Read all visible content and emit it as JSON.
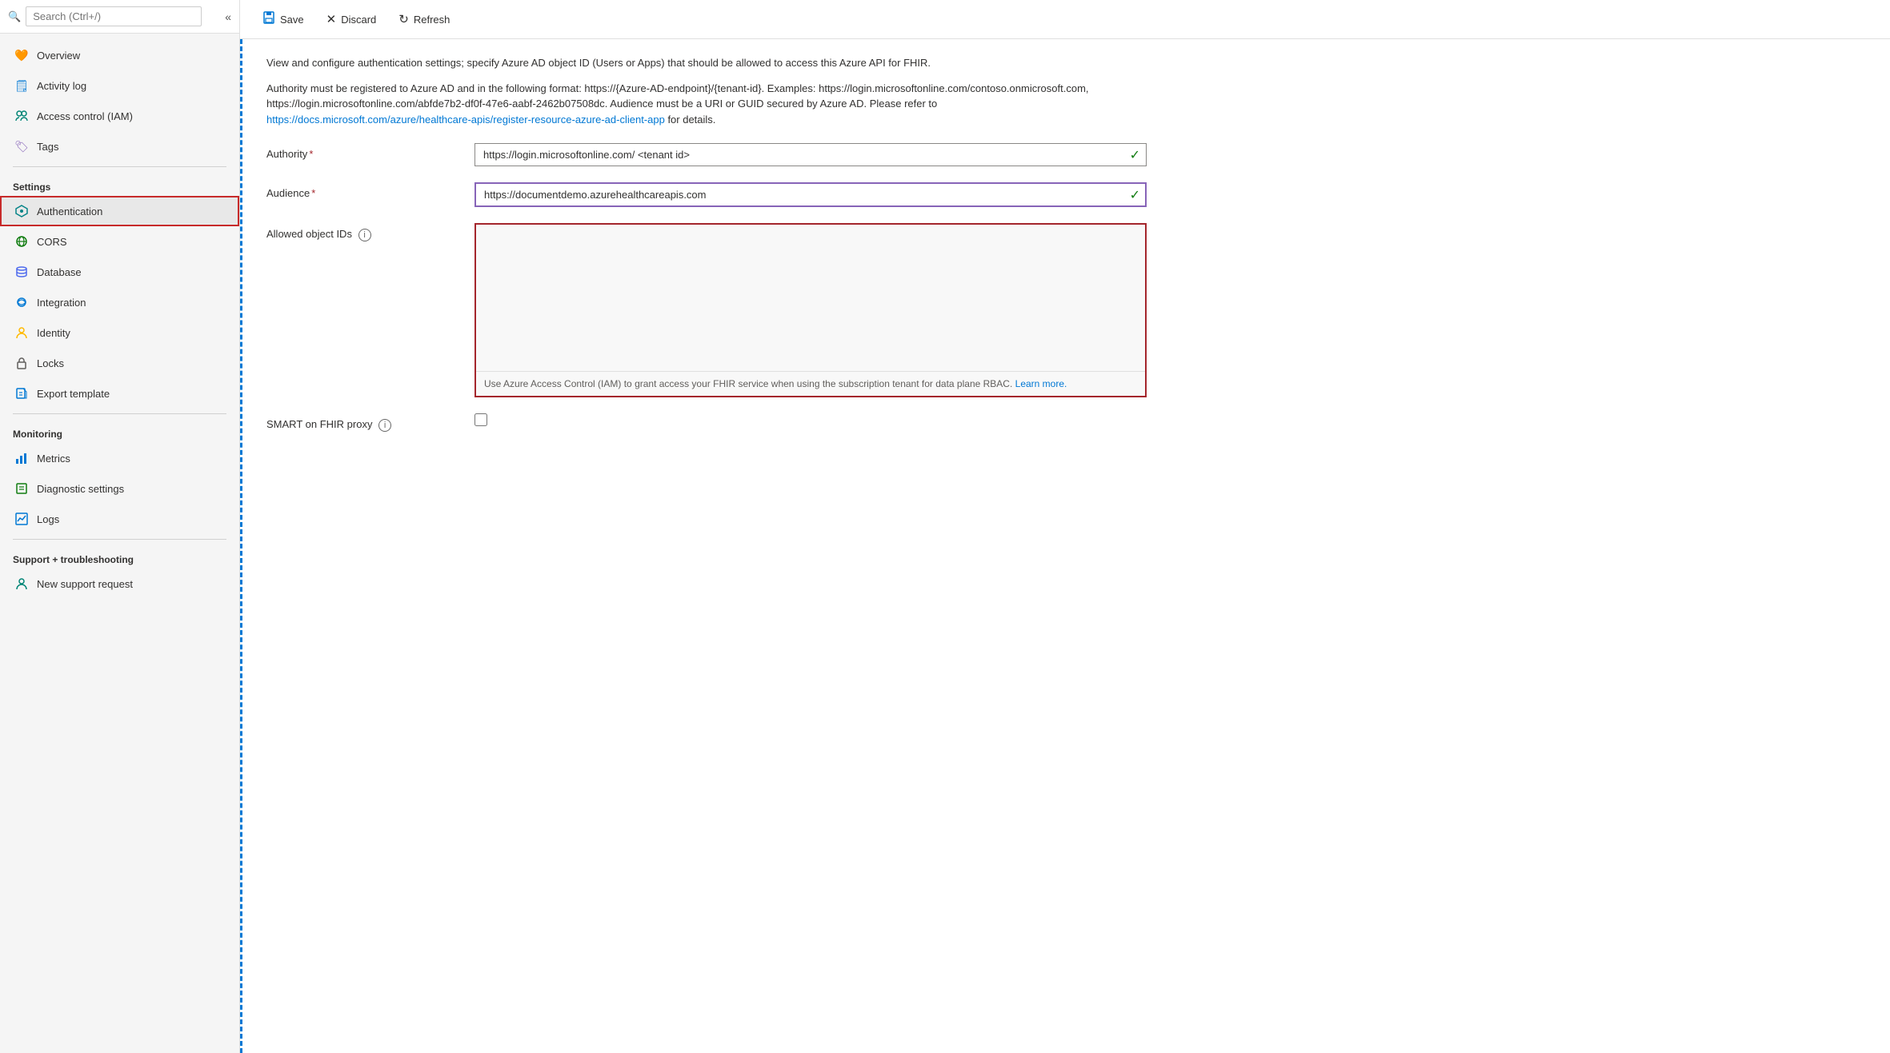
{
  "sidebar": {
    "search_placeholder": "Search (Ctrl+/)",
    "collapse_icon": "«",
    "items": [
      {
        "id": "overview",
        "label": "Overview",
        "icon": "🧡",
        "icon_class": "icon-orange",
        "active": false
      },
      {
        "id": "activity-log",
        "label": "Activity log",
        "icon": "🗒",
        "icon_class": "icon-blue",
        "active": false
      },
      {
        "id": "access-control",
        "label": "Access control (IAM)",
        "icon": "👥",
        "icon_class": "icon-teal",
        "active": false
      },
      {
        "id": "tags",
        "label": "Tags",
        "icon": "🏷",
        "icon_class": "icon-purple",
        "active": false
      }
    ],
    "settings_label": "Settings",
    "settings_items": [
      {
        "id": "authentication",
        "label": "Authentication",
        "icon": "💠",
        "icon_class": "icon-cyan",
        "active": true
      },
      {
        "id": "cors",
        "label": "CORS",
        "icon": "🌐",
        "icon_class": "icon-green",
        "active": false
      },
      {
        "id": "database",
        "label": "Database",
        "icon": "🗄",
        "icon_class": "icon-indigo",
        "active": false
      },
      {
        "id": "integration",
        "label": "Integration",
        "icon": "☁",
        "icon_class": "icon-blue",
        "active": false
      },
      {
        "id": "identity",
        "label": "Identity",
        "icon": "🔑",
        "icon_class": "icon-yellow",
        "active": false
      },
      {
        "id": "locks",
        "label": "Locks",
        "icon": "🔒",
        "icon_class": "icon-gray",
        "active": false
      },
      {
        "id": "export-template",
        "label": "Export template",
        "icon": "📤",
        "icon_class": "icon-blue",
        "active": false
      }
    ],
    "monitoring_label": "Monitoring",
    "monitoring_items": [
      {
        "id": "metrics",
        "label": "Metrics",
        "icon": "📊",
        "icon_class": "icon-blue",
        "active": false
      },
      {
        "id": "diagnostic-settings",
        "label": "Diagnostic settings",
        "icon": "📋",
        "icon_class": "icon-green",
        "active": false
      },
      {
        "id": "logs",
        "label": "Logs",
        "icon": "📉",
        "icon_class": "icon-blue",
        "active": false
      }
    ],
    "support_label": "Support + troubleshooting",
    "support_items": [
      {
        "id": "new-support-request",
        "label": "New support request",
        "icon": "👤",
        "icon_class": "icon-teal",
        "active": false
      }
    ]
  },
  "toolbar": {
    "save_label": "Save",
    "discard_label": "Discard",
    "refresh_label": "Refresh"
  },
  "main": {
    "description1": "View and configure authentication settings; specify Azure AD object ID (Users or Apps) that should be allowed to access this Azure API for FHIR.",
    "description2_before": "Authority must be registered to Azure AD and in the following format: https://{Azure-AD-endpoint}/{tenant-id}. Examples: https://login.microsoftonline.com/contoso.onmicrosoft.com, https://login.microsoftonline.com/abfde7b2-df0f-47e6-aabf-2462b07508dc. Audience must be a URI or GUID secured by Azure AD. Please refer to ",
    "description2_link_text": "https://docs.microsoft.com/azure/healthcare-apis/register-resource-azure-ad-client-app",
    "description2_link_href": "https://docs.microsoft.com/azure/healthcare-apis/register-resource-azure-ad-client-app",
    "description2_after": " for details.",
    "authority_label": "Authority",
    "authority_required": "*",
    "authority_value": "https://login.microsoftonline.com/ <tenant id>",
    "audience_label": "Audience",
    "audience_required": "*",
    "audience_value": "https://documentdemo.azurehealthcareapis.com",
    "allowed_ids_label": "Allowed object IDs",
    "allowed_ids_hint": "Use Azure Access Control (IAM) to grant access your FHIR service when using the subscription tenant for data plane RBAC.",
    "allowed_ids_link_text": "Learn more.",
    "smart_proxy_label": "SMART on FHIR proxy"
  }
}
